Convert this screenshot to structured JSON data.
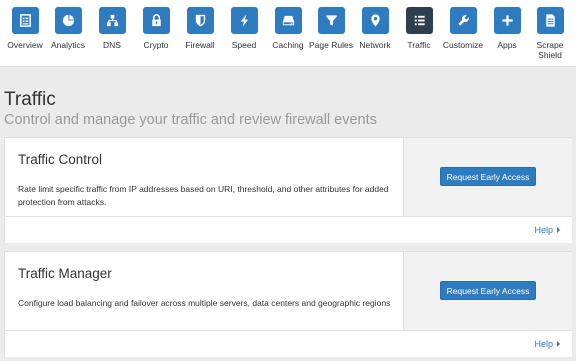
{
  "nav": {
    "items": [
      {
        "label": "Overview",
        "icon": "overview-icon"
      },
      {
        "label": "Analytics",
        "icon": "pie-chart-icon"
      },
      {
        "label": "DNS",
        "icon": "network-tree-icon"
      },
      {
        "label": "Crypto",
        "icon": "lock-icon"
      },
      {
        "label": "Firewall",
        "icon": "shield-icon"
      },
      {
        "label": "Speed",
        "icon": "lightning-icon"
      },
      {
        "label": "Caching",
        "icon": "hard-drive-icon"
      },
      {
        "label": "Page Rules",
        "icon": "filter-icon"
      },
      {
        "label": "Network",
        "icon": "map-pin-icon"
      },
      {
        "label": "Traffic",
        "icon": "list-icon",
        "active": true
      },
      {
        "label": "Customize",
        "icon": "wrench-icon"
      },
      {
        "label": "Apps",
        "icon": "plus-icon"
      },
      {
        "label": "Scrape Shield",
        "icon": "document-icon"
      }
    ],
    "colors": {
      "icon_bg": "#2f7bbf",
      "icon_bg_active": "#2f3e50"
    }
  },
  "page": {
    "title": "Traffic",
    "subtitle": "Control and manage your traffic and review firewall events"
  },
  "cards": [
    {
      "title": "Traffic Control",
      "description": "Rate limit specific traffic from IP addresses based on URI, threshold, and other attributes for added protection from attacks.",
      "button_label": "Request Early Access",
      "help_label": "Help"
    },
    {
      "title": "Traffic Manager",
      "description": "Configure load balancing and failover across multiple servers, data centers and geographic regions",
      "button_label": "Request Early Access",
      "help_label": "Help"
    }
  ]
}
